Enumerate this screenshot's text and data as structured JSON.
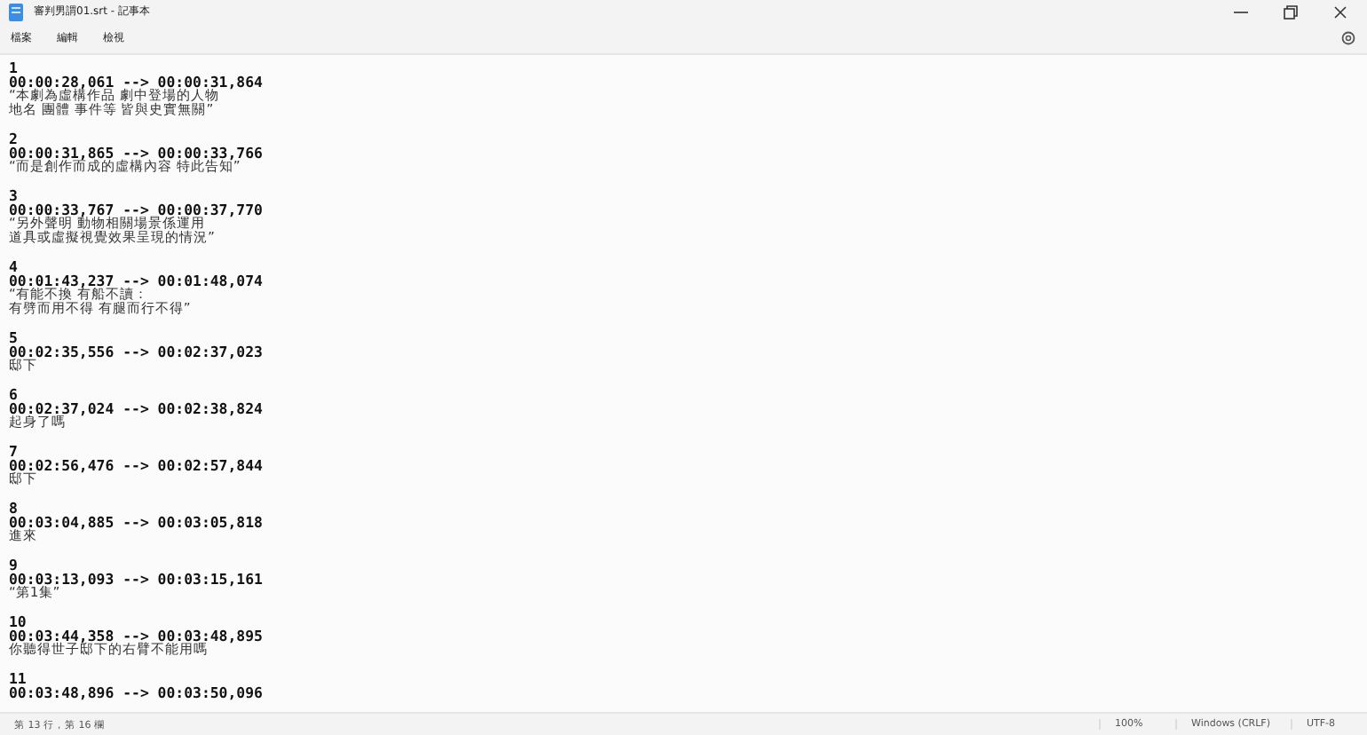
{
  "window": {
    "title": "審判男謂01.srt - 記事本"
  },
  "menu": [
    {
      "label": "檔案"
    },
    {
      "label": "編輯"
    },
    {
      "label": "檢視"
    }
  ],
  "entries": [
    {
      "index": "1",
      "time": "00:00:28,061 --> 00:00:31,864",
      "lines": [
        "“本劇為虛構作品 劇中登場的人物",
        "地名 團體 事件等 皆與史實無關”"
      ]
    },
    {
      "index": "2",
      "time": "00:00:31,865 --> 00:00:33,766",
      "lines": [
        "“而是創作而成的虛構內容 特此告知”"
      ]
    },
    {
      "index": "3",
      "time": "00:00:33,767 --> 00:00:37,770",
      "lines": [
        "“另外聲明 動物相關場景係運用",
        "道具或虛擬視覺效果呈現的情況”"
      ]
    },
    {
      "index": "4",
      "time": "00:01:43,237 --> 00:01:48,074",
      "lines": [
        "“有能不換 有船不讀：",
        "有劈而用不得 有腿而行不得”"
      ]
    },
    {
      "index": "5",
      "time": "00:02:35,556 --> 00:02:37,023",
      "lines": [
        "邸下"
      ]
    },
    {
      "index": "6",
      "time": "00:02:37,024 --> 00:02:38,824",
      "lines": [
        "起身了嗎"
      ]
    },
    {
      "index": "7",
      "time": "00:02:56,476 --> 00:02:57,844",
      "lines": [
        "邸下"
      ]
    },
    {
      "index": "8",
      "time": "00:03:04,885 --> 00:03:05,818",
      "lines": [
        "進來"
      ]
    },
    {
      "index": "9",
      "time": "00:03:13,093 --> 00:03:15,161",
      "lines": [
        "“第1集”"
      ]
    },
    {
      "index": "10",
      "time": "00:03:44,358 --> 00:03:48,895",
      "lines": [
        "你聽得世子邸下的右臂不能用嗎"
      ]
    },
    {
      "index": "11",
      "time": "00:03:48,896 --> 00:03:50,096"
    }
  ],
  "status_bar": {
    "position": "第 13 行，第 16 欄",
    "zoom": "100%",
    "line_ending": "Windows (CRLF)",
    "encoding": "UTF-8"
  }
}
